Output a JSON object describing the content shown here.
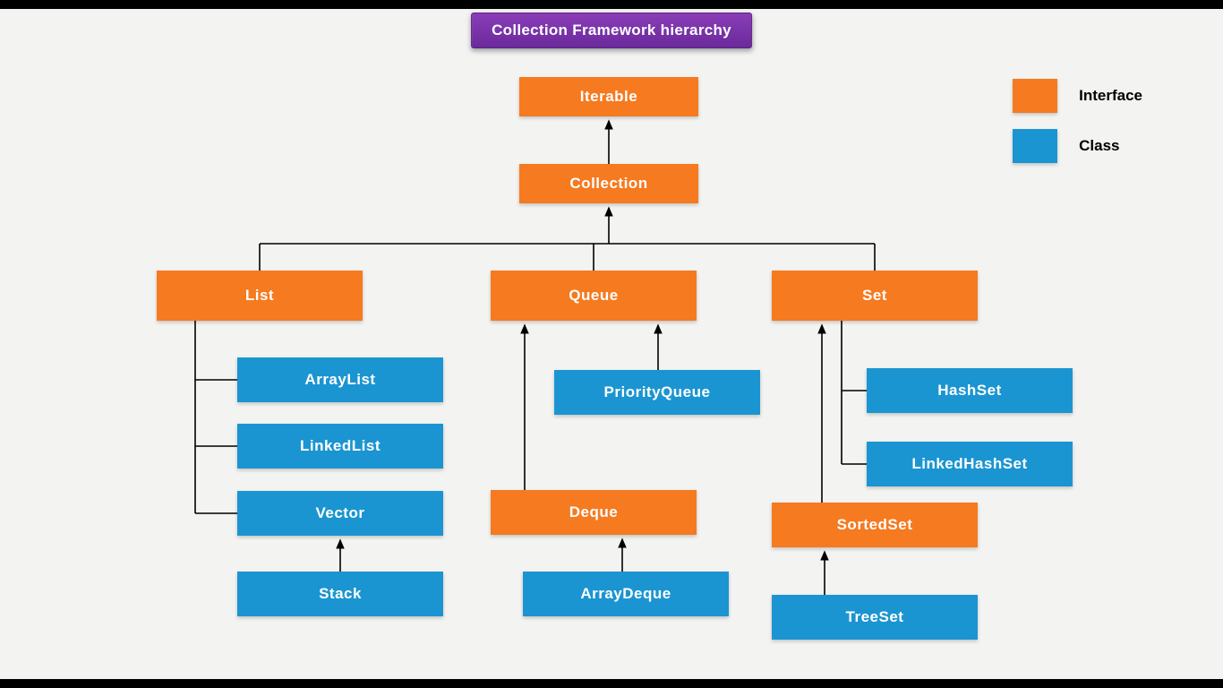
{
  "title": "Collection Framework hierarchy",
  "legend": {
    "interface": "Interface",
    "class": "Class"
  },
  "colors": {
    "interface": "#f57a20",
    "class": "#1b95d1",
    "title_bg": "#7a33a8"
  },
  "nodes": {
    "iterable": {
      "label": "Iterable",
      "type": "interface"
    },
    "collection": {
      "label": "Collection",
      "type": "interface"
    },
    "list": {
      "label": "List",
      "type": "interface"
    },
    "queue": {
      "label": "Queue",
      "type": "interface"
    },
    "set": {
      "label": "Set",
      "type": "interface"
    },
    "arraylist": {
      "label": "ArrayList",
      "type": "class"
    },
    "linkedlist": {
      "label": "LinkedList",
      "type": "class"
    },
    "vector": {
      "label": "Vector",
      "type": "class"
    },
    "stack": {
      "label": "Stack",
      "type": "class"
    },
    "priorityqueue": {
      "label": "PriorityQueue",
      "type": "class"
    },
    "deque": {
      "label": "Deque",
      "type": "interface"
    },
    "arraydeque": {
      "label": "ArrayDeque",
      "type": "class"
    },
    "hashset": {
      "label": "HashSet",
      "type": "class"
    },
    "linkedhashset": {
      "label": "LinkedHashSet",
      "type": "class"
    },
    "sortedset": {
      "label": "SortedSet",
      "type": "interface"
    },
    "treeset": {
      "label": "TreeSet",
      "type": "class"
    }
  }
}
